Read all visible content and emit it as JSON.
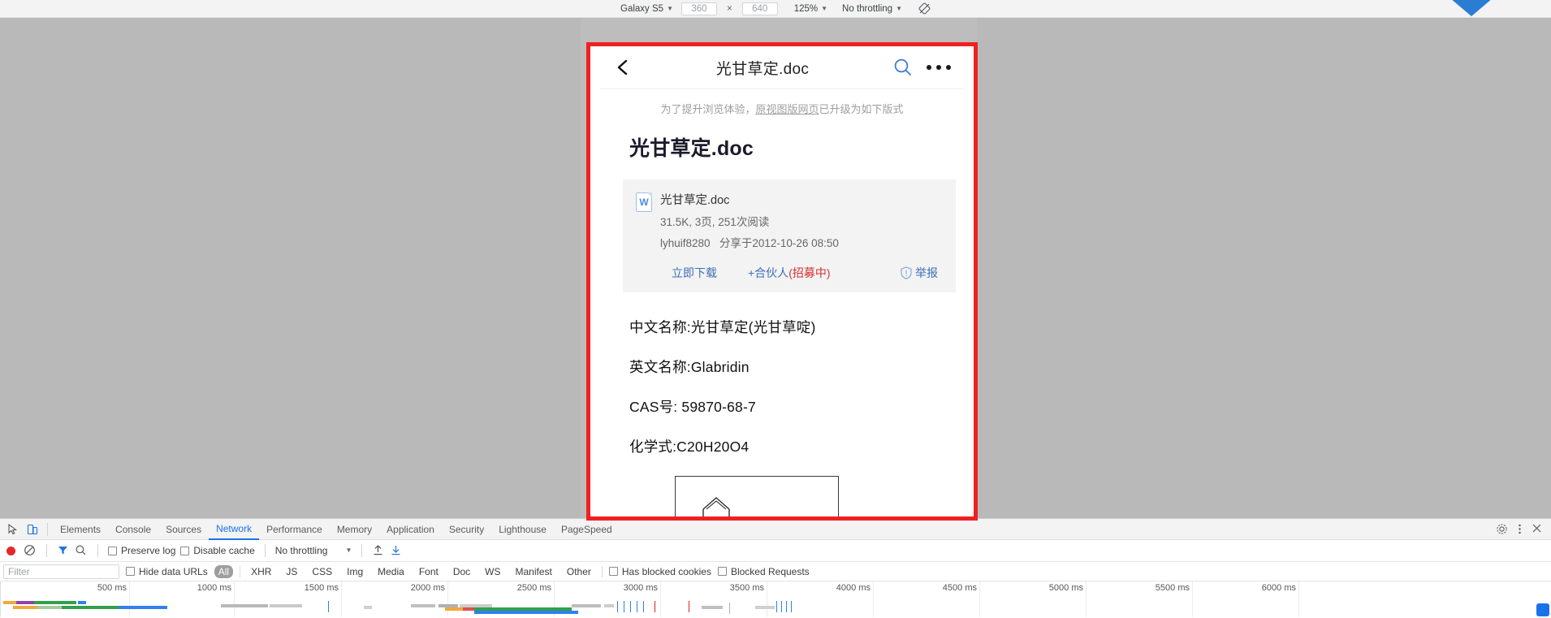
{
  "device_toolbar": {
    "device_name": "Galaxy S5",
    "width": "360",
    "height": "640",
    "zoom": "125%",
    "throttling": "No throttling",
    "rotate_icon": "rotate-icon"
  },
  "mobile_page": {
    "header": {
      "back_icon": "back-chevron-icon",
      "title": "光甘草定.doc",
      "search_icon": "search-icon",
      "menu_icon": "more-options-icon"
    },
    "notice": {
      "prefix": "为了提升浏览体验，",
      "link": "原视图版网页",
      "suffix": "已升级为如下版式"
    },
    "doc_title": "光甘草定.doc",
    "file_card": {
      "icon": "word-doc-icon",
      "icon_letter": "W",
      "file_name": "光甘草定.doc",
      "meta": "31.5K, 3页, 251次阅读",
      "owner": "lyhuif8280",
      "shared_on": "分享于2012-10-26 08:50",
      "actions": {
        "download": "立即下载",
        "partner_prefix": "+合伙人",
        "partner_highlight": "(招募中)",
        "report": "举报",
        "report_icon": "shield-report-icon"
      }
    },
    "body_lines": [
      "中文名称:光甘草定(光甘草啶)",
      "英文名称:Glabridin",
      "CAS号: 59870-68-7",
      "化学式:C20H20O4"
    ]
  },
  "devtools": {
    "icons": {
      "inspect": "inspect-element-icon",
      "device_toggle": "device-toolbar-icon",
      "settings": "gear-icon",
      "more": "more-vertical-icon",
      "close": "close-icon"
    },
    "tabs": [
      {
        "label": "Elements",
        "active": false
      },
      {
        "label": "Console",
        "active": false
      },
      {
        "label": "Sources",
        "active": false
      },
      {
        "label": "Network",
        "active": true
      },
      {
        "label": "Performance",
        "active": false
      },
      {
        "label": "Memory",
        "active": false
      },
      {
        "label": "Application",
        "active": false
      },
      {
        "label": "Security",
        "active": false
      },
      {
        "label": "Lighthouse",
        "active": false
      },
      {
        "label": "PageSpeed",
        "active": false
      }
    ],
    "network_toolbar": {
      "record_icon": "record-button-icon",
      "clear_icon": "clear-icon",
      "filter_icon": "filter-icon",
      "search_icon": "search-icon",
      "preserve_log": "Preserve log",
      "disable_cache": "Disable cache",
      "throttling": "No throttling",
      "import_icon": "import-har-icon",
      "export_icon": "export-har-icon"
    },
    "filter_bar": {
      "filter_placeholder": "Filter",
      "hide_data_urls": "Hide data URLs",
      "types": [
        "All",
        "XHR",
        "JS",
        "CSS",
        "Img",
        "Media",
        "Font",
        "Doc",
        "WS",
        "Manifest",
        "Other"
      ],
      "selected_type": "All",
      "has_blocked_cookies": "Has blocked cookies",
      "blocked_requests": "Blocked Requests"
    },
    "timeline": {
      "ticks": [
        "500 ms",
        "1000 ms",
        "1500 ms",
        "2000 ms",
        "2500 ms",
        "3000 ms",
        "3500 ms",
        "4000 ms",
        "4500 ms",
        "5000 ms",
        "5500 ms",
        "6000 ms"
      ]
    }
  },
  "colors": {
    "accent": "#1a73e8",
    "highlight_frame": "#f02020",
    "record": "#e8262a",
    "link": "#3b6fb5",
    "warn": "#d83030"
  }
}
